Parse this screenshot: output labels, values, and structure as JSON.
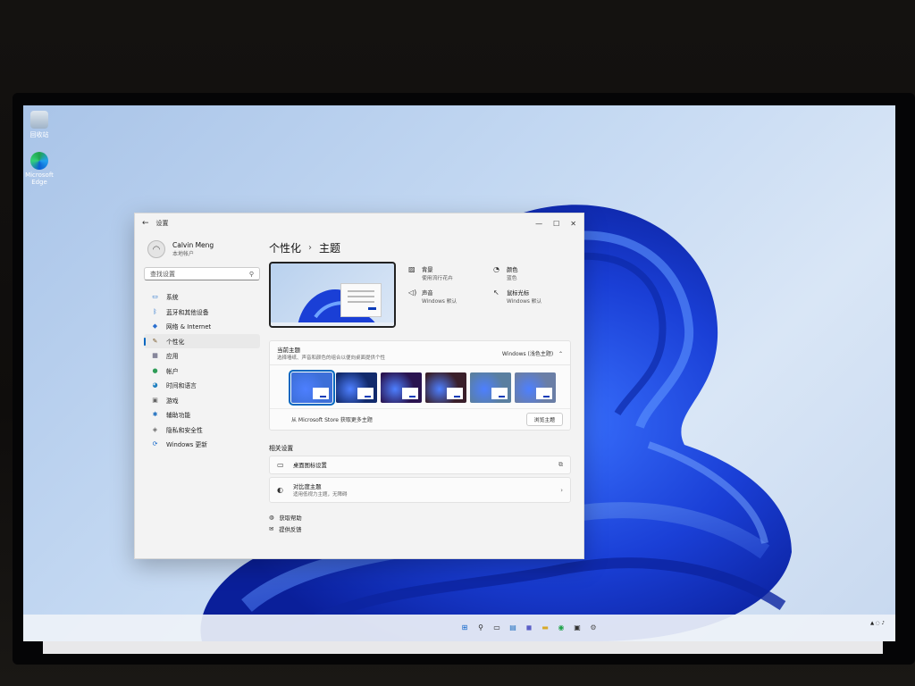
{
  "desktop": {
    "icons": [
      {
        "label": "回收站",
        "icon": "recycle-bin-icon"
      },
      {
        "label": "Microsoft Edge",
        "icon": "edge-icon"
      }
    ]
  },
  "window": {
    "title": "设置",
    "controls": {
      "minimize": "—",
      "maximize": "☐",
      "close": "✕"
    },
    "back": "←"
  },
  "sidebar": {
    "user_name": "Calvin Meng",
    "user_sub": "本地帐户",
    "search_placeholder": "查找设置",
    "items": [
      {
        "label": "系统",
        "icon": "monitor-icon",
        "glyph": "▭",
        "color": "#0a62c9"
      },
      {
        "label": "蓝牙和其他设备",
        "icon": "bluetooth-icon",
        "glyph": "ᛒ",
        "color": "#0a62c9"
      },
      {
        "label": "网络 & Internet",
        "icon": "wifi-icon",
        "glyph": "◆",
        "color": "#2a6fcf"
      },
      {
        "label": "个性化",
        "icon": "brush-icon",
        "glyph": "✎",
        "color": "#7a5a2a"
      },
      {
        "label": "应用",
        "icon": "apps-icon",
        "glyph": "▦",
        "color": "#4a4a6a"
      },
      {
        "label": "帐户",
        "icon": "person-icon",
        "glyph": "●",
        "color": "#2e9c57"
      },
      {
        "label": "时间和语言",
        "icon": "globe-icon",
        "glyph": "◕",
        "color": "#1f7fbf"
      },
      {
        "label": "游戏",
        "icon": "gamepad-icon",
        "glyph": "▣",
        "color": "#666"
      },
      {
        "label": "辅助功能",
        "icon": "accessibility-icon",
        "glyph": "✱",
        "color": "#1f6fbf"
      },
      {
        "label": "隐私和安全性",
        "icon": "shield-icon",
        "glyph": "◈",
        "color": "#666"
      },
      {
        "label": "Windows 更新",
        "icon": "update-icon",
        "glyph": "⟳",
        "color": "#0a62c9"
      }
    ],
    "active_index": 3
  },
  "main": {
    "breadcrumb_parent": "个性化",
    "breadcrumb_sep": "›",
    "breadcrumb_current": "主题",
    "properties": [
      {
        "title": "背景",
        "sub": "使用流行花卉",
        "icon": "image-icon",
        "glyph": "▨"
      },
      {
        "title": "颜色",
        "sub": "蓝色",
        "icon": "palette-icon",
        "glyph": "◔"
      },
      {
        "title": "声音",
        "sub": "Windows 默认",
        "icon": "speaker-icon",
        "glyph": "◁)"
      },
      {
        "title": "鼠标光标",
        "sub": "Windows 默认",
        "icon": "cursor-icon",
        "glyph": "↖"
      }
    ],
    "current_theme": {
      "title": "当前主题",
      "sub": "选择墙纸、声音和颜色的组合以便向桌面提供个性",
      "value": "Windows (浅色主题)",
      "chevron": "⌃"
    },
    "themes": [
      {
        "name": "windows-light-theme",
        "bg": "#3d6fd8",
        "selected": true
      },
      {
        "name": "windows-dark-theme",
        "bg": "#122a6c",
        "selected": false
      },
      {
        "name": "glow-theme",
        "bg": "#2a1450",
        "selected": false
      },
      {
        "name": "captured-motion-theme",
        "bg": "#3a1f2a",
        "selected": false
      },
      {
        "name": "sunrise-theme",
        "bg": "#5a7fa0",
        "selected": false
      },
      {
        "name": "flow-theme",
        "bg": "#6a7ea6",
        "selected": false
      }
    ],
    "store_text": "从 Microsoft Store 获取更多主题",
    "browse_label": "浏览主题",
    "related_title": "相关设置",
    "related": [
      {
        "title": "桌面图标设置",
        "sub": "",
        "icon": "desktop-icon",
        "glyph": "▭",
        "arrow": "⧉"
      },
      {
        "title": "对比度主题",
        "sub": "适用低视力主题，无障碍",
        "icon": "contrast-icon",
        "glyph": "◐",
        "arrow": "›"
      }
    ],
    "links": [
      {
        "label": "获取帮助",
        "icon": "help-icon",
        "glyph": "◍"
      },
      {
        "label": "提供反馈",
        "icon": "feedback-icon",
        "glyph": "✉"
      }
    ]
  },
  "taskbar": {
    "icons": [
      {
        "name": "start-icon",
        "glyph": "⊞",
        "color": "#0a62c9"
      },
      {
        "name": "search-icon",
        "glyph": "⚲",
        "color": "#222"
      },
      {
        "name": "task-view-icon",
        "glyph": "▭",
        "color": "#222"
      },
      {
        "name": "widgets-icon",
        "glyph": "▤",
        "color": "#1f6fbf"
      },
      {
        "name": "chat-icon",
        "glyph": "◼",
        "color": "#5b5fc7"
      },
      {
        "name": "explorer-icon",
        "glyph": "▬",
        "color": "#d8a928"
      },
      {
        "name": "edge-icon",
        "glyph": "◉",
        "color": "#1fa24a"
      },
      {
        "name": "store-icon",
        "glyph": "▣",
        "color": "#333"
      },
      {
        "name": "settings-icon",
        "glyph": "⚙",
        "color": "#555"
      }
    ]
  },
  "colors": {
    "accent": "#0067c0",
    "wallpaper_bloom": "#1f3fd8"
  }
}
